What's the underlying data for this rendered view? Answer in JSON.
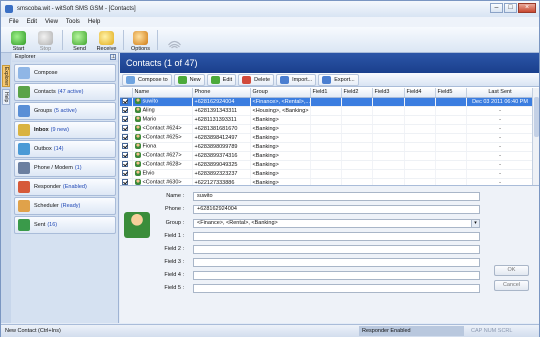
{
  "window": {
    "title": "smscoba.wit - witSoft SMS GSM - [Contacts]"
  },
  "menu": [
    "File",
    "Edit",
    "View",
    "Tools",
    "Help"
  ],
  "toolbar": [
    {
      "label": "Start",
      "icon": "start-icon"
    },
    {
      "label": "Stop",
      "icon": "stop-icon"
    },
    {
      "label": "Send",
      "icon": "send-icon"
    },
    {
      "label": "Receive",
      "icon": "receive-icon"
    },
    {
      "label": "Options",
      "icon": "options-icon"
    }
  ],
  "sidebar": {
    "header": "Explorer",
    "tabs": [
      "Explorer",
      "Help"
    ],
    "items": [
      {
        "label": "Compose",
        "count": "",
        "icon": "compose-icon",
        "color": "#8fb6e6"
      },
      {
        "label": "Contacts",
        "count": "(47 active)",
        "icon": "contacts-icon",
        "color": "#5aa348"
      },
      {
        "label": "Groups",
        "count": "(5 active)",
        "icon": "groups-icon",
        "color": "#5a8fd6"
      },
      {
        "label": "Inbox",
        "count": "(9 new)",
        "icon": "inbox-icon",
        "color": "#d9b341"
      },
      {
        "label": "Outbox",
        "count": "(14)",
        "icon": "outbox-icon",
        "color": "#4a9ad6"
      },
      {
        "label": "Phone / Modem",
        "count": "(1)",
        "icon": "phone-icon",
        "color": "#6b7fa0"
      },
      {
        "label": "Responder",
        "count": "(Enabled)",
        "icon": "responder-icon",
        "color": "#d65a3a"
      },
      {
        "label": "Scheduler",
        "count": "(Ready)",
        "icon": "scheduler-icon",
        "color": "#e0a24a"
      },
      {
        "label": "Sent",
        "count": "(16)",
        "icon": "sent-icon",
        "color": "#3a9a4a"
      }
    ]
  },
  "main": {
    "title": "Contacts (1 of 47)",
    "actions": [
      {
        "label": "Compose to",
        "icon": "compose-to-icon",
        "color": "#6fa4e0"
      },
      {
        "label": "New",
        "icon": "new-icon",
        "color": "#4caa3a"
      },
      {
        "label": "Edit",
        "icon": "edit-icon",
        "color": "#4caa3a"
      },
      {
        "label": "Delete",
        "icon": "delete-icon",
        "color": "#d24a3a"
      },
      {
        "label": "Import...",
        "icon": "import-icon",
        "color": "#4a7ed0"
      },
      {
        "label": "Export...",
        "icon": "export-icon",
        "color": "#4a7ed0"
      }
    ],
    "columns": [
      "Name",
      "Phone",
      "Group",
      "Field1",
      "Field2",
      "Field3",
      "Field4",
      "Field5",
      "Last Sent"
    ],
    "rows": [
      {
        "name": "suwito",
        "phone": "+628162924004",
        "group": "<Finance>, <Rental>,...",
        "last": "Dec 03 2011 06:40 PM",
        "sel": true
      },
      {
        "name": "Aling",
        "phone": "+6281391343311",
        "group": "<Housing>, <Banking>",
        "last": "-"
      },
      {
        "name": "Mario",
        "phone": "+6281131393311",
        "group": "<Banking>",
        "last": "-"
      },
      {
        "name": "<Contact #624>",
        "phone": "+6281381681670",
        "group": "<Banking>",
        "last": "-"
      },
      {
        "name": "<Contact #625>",
        "phone": "+6283898412497",
        "group": "<Banking>",
        "last": "-"
      },
      {
        "name": "Fiona",
        "phone": "+6283898099789",
        "group": "<Banking>",
        "last": "-"
      },
      {
        "name": "<Contact #627>",
        "phone": "+6283899374316",
        "group": "<Banking>",
        "last": "-"
      },
      {
        "name": "<Contact #628>",
        "phone": "+6283899049325",
        "group": "<Banking>",
        "last": "-"
      },
      {
        "name": "Elvio",
        "phone": "+6283892323237",
        "group": "<Banking>",
        "last": "-"
      },
      {
        "name": "<Contact #630>",
        "phone": "+622127333886",
        "group": "<Banking>",
        "last": "-"
      }
    ]
  },
  "detail": {
    "labels": {
      "name": "Name :",
      "phone": "Phone :",
      "group": "Group :",
      "f1": "Field 1 :",
      "f2": "Field 2 :",
      "f3": "Field 3 :",
      "f4": "Field 4 :",
      "f5": "Field 5 :"
    },
    "values": {
      "name": "suwito",
      "phone": "+628162924004",
      "group": "<Finance>, <Rental>, <Banking>",
      "f1": "",
      "f2": "",
      "f3": "",
      "f4": "",
      "f5": ""
    },
    "ok": "OK",
    "cancel": "Cancel"
  },
  "status": {
    "left": "New Contact (Ctrl+Ins)",
    "mid": "Responder Enabled",
    "right": "CAP  NUM  SCRL"
  }
}
